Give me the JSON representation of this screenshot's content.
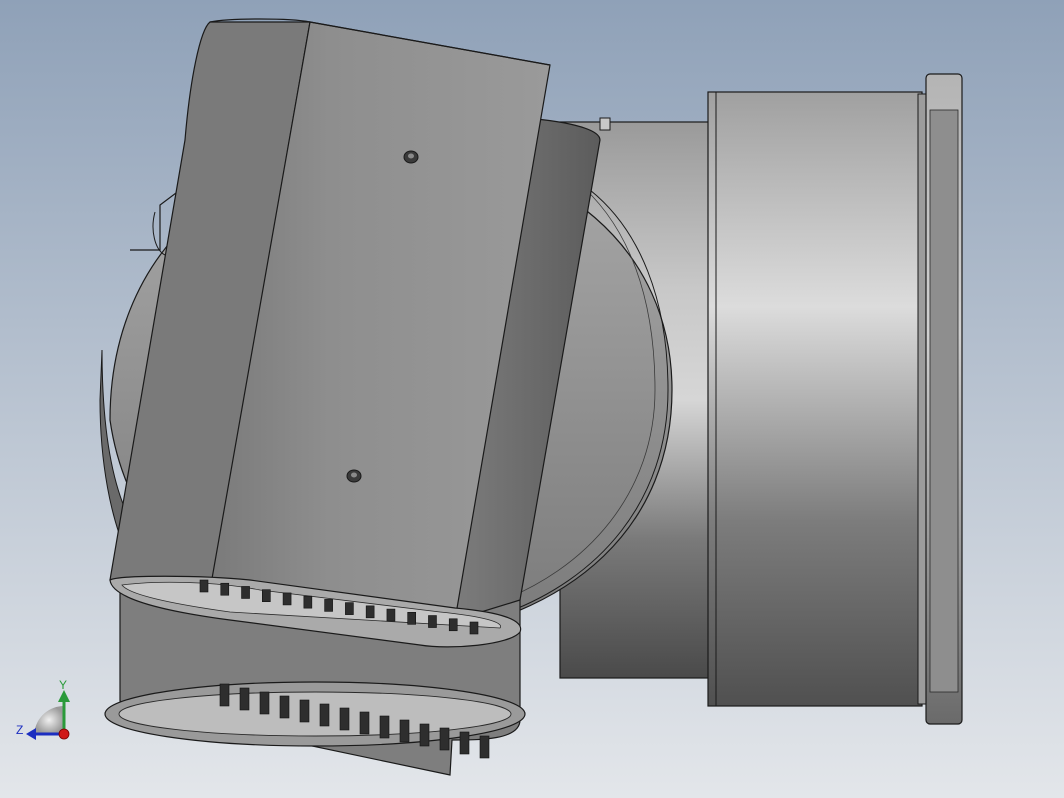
{
  "viewport": {
    "background_top": "#8fa1b8",
    "background_bottom": "#e3e6ea"
  },
  "triad": {
    "y_label": "Y",
    "z_label": "Z",
    "y_color": "#2a9a3a",
    "z_color": "#1c2ec0",
    "x_color": "#d01818"
  },
  "model": {
    "body_color": "#8c8c8c",
    "edge_color": "#1a1a1a",
    "hole_count": 2,
    "vent_slots_per_row": 14
  }
}
